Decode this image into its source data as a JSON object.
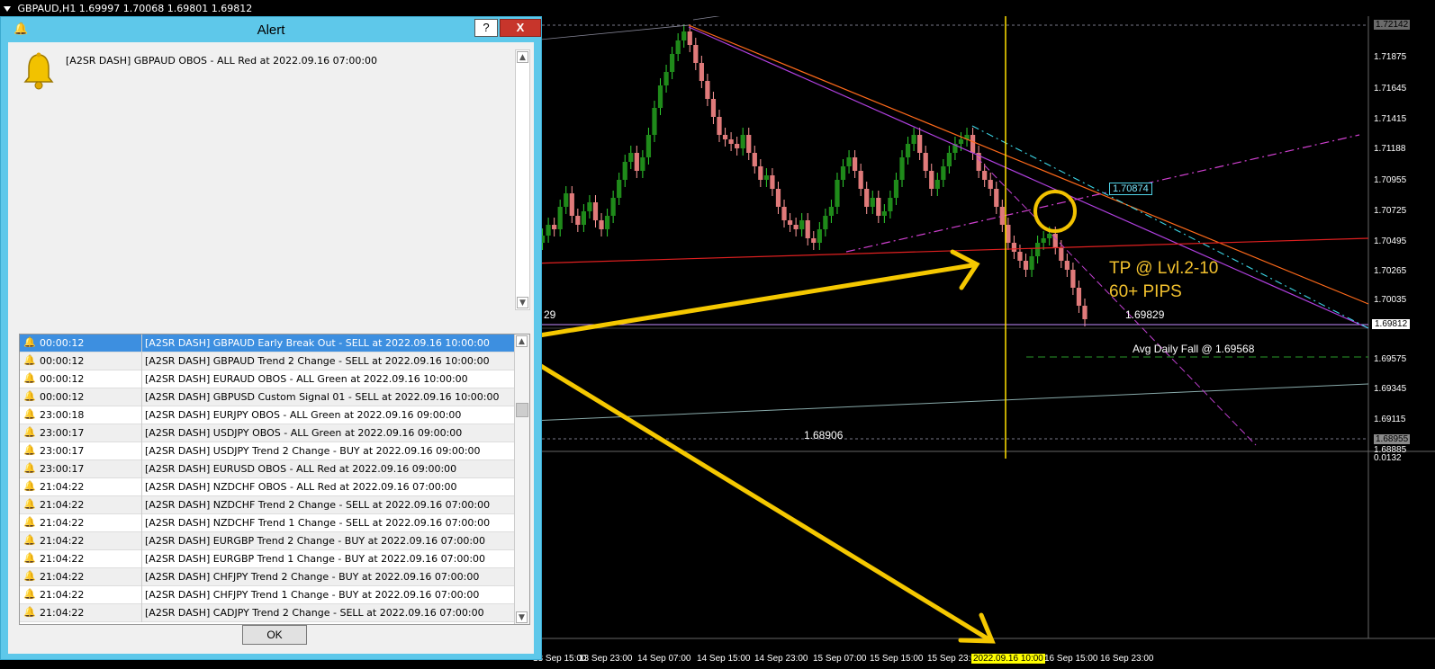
{
  "chart": {
    "title": "GBPAUD,H1  1.69997 1.70068 1.69801 1.69812",
    "price_levels": [
      "1.72142",
      "1.71875",
      "1.71645",
      "1.71415",
      "1.71188",
      "1.70955",
      "1.70725",
      "1.70495",
      "1.70265",
      "1.70035",
      "1.69812",
      "1.69575",
      "1.69345",
      "1.69115",
      "1.68955",
      "1.68885",
      "0.0132"
    ],
    "current_price_tag": "1.69812",
    "time_labels": [
      "13 Sep 15:00",
      "13 Sep 23:00",
      "14 Sep 07:00",
      "14 Sep 15:00",
      "14 Sep 23:00",
      "15 Sep 07:00",
      "15 Sep 15:00",
      "15 Sep 23:00",
      "2022.09.16 10:00",
      "16 Sep 15:00",
      "16 Sep 23:00"
    ],
    "highlighted_time": "2022.09.16 10:00",
    "annotations": {
      "tp_line1": "TP @ Lvl.2-10",
      "tp_line2": "60+ PIPS",
      "price_1": "1.69829",
      "price_1_left": "29",
      "avg_fall": "Avg Daily Fall @ 1.69568",
      "price_2": "1.68906",
      "box_label": "1.70874"
    },
    "colors": {
      "bull": "#1f8a1a",
      "bear": "#e07a7a",
      "highlight": "#ffe000",
      "trend_orange": "#ff6a1a",
      "trend_purple": "#c24fe0"
    }
  },
  "dialog": {
    "title": "Alert",
    "help_label": "?",
    "close_label": "X",
    "message": "[A2SR DASH] GBPAUD OBOS - ALL Red at 2022.09.16 07:00:00",
    "ok_label": "OK",
    "rows": [
      {
        "time": "00:00:12",
        "text": "[A2SR DASH] GBPAUD Early Break Out - SELL at 2022.09.16 10:00:00"
      },
      {
        "time": "00:00:12",
        "text": "[A2SR DASH] GBPAUD Trend 2 Change - SELL at 2022.09.16 10:00:00"
      },
      {
        "time": "00:00:12",
        "text": "[A2SR DASH] EURAUD OBOS - ALL Green at 2022.09.16 10:00:00"
      },
      {
        "time": "00:00:12",
        "text": "[A2SR DASH] GBPUSD Custom Signal 01 - SELL at 2022.09.16 10:00:00"
      },
      {
        "time": "23:00:18",
        "text": "[A2SR DASH] EURJPY OBOS - ALL Green at 2022.09.16 09:00:00"
      },
      {
        "time": "23:00:17",
        "text": "[A2SR DASH] USDJPY OBOS - ALL Green at 2022.09.16 09:00:00"
      },
      {
        "time": "23:00:17",
        "text": "[A2SR DASH] USDJPY Trend 2 Change - BUY at 2022.09.16 09:00:00"
      },
      {
        "time": "23:00:17",
        "text": "[A2SR DASH] EURUSD OBOS - ALL Red at 2022.09.16 09:00:00"
      },
      {
        "time": "21:04:22",
        "text": "[A2SR DASH] NZDCHF OBOS - ALL Red at 2022.09.16 07:00:00"
      },
      {
        "time": "21:04:22",
        "text": "[A2SR DASH] NZDCHF Trend 2 Change - SELL at 2022.09.16 07:00:00"
      },
      {
        "time": "21:04:22",
        "text": "[A2SR DASH] NZDCHF Trend 1 Change - SELL at 2022.09.16 07:00:00"
      },
      {
        "time": "21:04:22",
        "text": "[A2SR DASH] EURGBP Trend 2 Change - BUY at 2022.09.16 07:00:00"
      },
      {
        "time": "21:04:22",
        "text": "[A2SR DASH] EURGBP Trend 1 Change - BUY at 2022.09.16 07:00:00"
      },
      {
        "time": "21:04:22",
        "text": "[A2SR DASH] CHFJPY Trend 2 Change - BUY at 2022.09.16 07:00:00"
      },
      {
        "time": "21:04:22",
        "text": "[A2SR DASH] CHFJPY Trend 1 Change - BUY at 2022.09.16 07:00:00"
      },
      {
        "time": "21:04:22",
        "text": "[A2SR DASH] CADJPY Trend 2 Change - SELL at 2022.09.16 07:00:00"
      }
    ]
  }
}
